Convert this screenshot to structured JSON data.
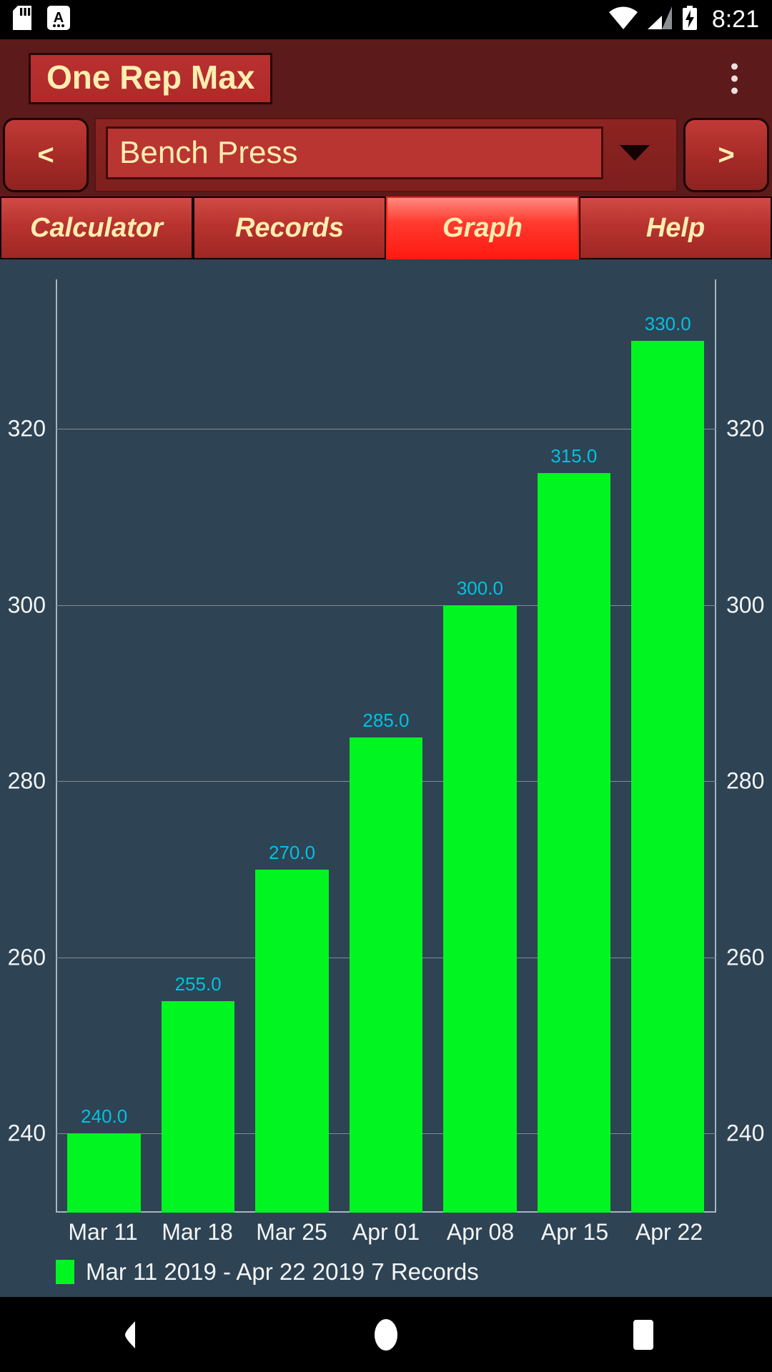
{
  "status_bar": {
    "icons_left": [
      "sd-card-icon",
      "keyboard-language-icon"
    ],
    "icons_right": [
      "wifi-icon",
      "cell-signal-icon",
      "battery-charging-icon"
    ],
    "time": "8:21"
  },
  "app_bar": {
    "title": "One Rep Max",
    "overflow_menu": "overflow-menu-icon",
    "title_text_color": "#ffeeb0",
    "title_box_color": "#b93030",
    "bar_color": "#5c1a1a"
  },
  "selector": {
    "prev_label": "<",
    "next_label": ">",
    "exercise_value": "Bench Press",
    "dropdown_icon": "chevron-down-icon"
  },
  "tabs": [
    {
      "label": "Calculator",
      "active": false
    },
    {
      "label": "Records",
      "active": false
    },
    {
      "label": "Graph",
      "active": true
    },
    {
      "label": "Help",
      "active": false
    }
  ],
  "chart_data": {
    "type": "bar",
    "title": "",
    "xlabel": "",
    "ylabel": "",
    "categories": [
      "Mar 11",
      "Mar 18",
      "Mar 25",
      "Apr 01",
      "Apr 08",
      "Apr 15",
      "Apr 22"
    ],
    "values": [
      240.0,
      255.0,
      270.0,
      285.0,
      300.0,
      315.0,
      330.0
    ],
    "value_labels": [
      "240.0",
      "255.0",
      "270.0",
      "285.0",
      "300.0",
      "315.0",
      "330.0"
    ],
    "yticks": [
      240,
      260,
      280,
      300,
      320
    ],
    "ytick_labels": [
      "240",
      "260",
      "280",
      "300",
      "320"
    ],
    "ylim": [
      231,
      337
    ],
    "y_axis_both_sides": true,
    "grid": true,
    "bar_color": "#00f521",
    "value_label_color": "#00c2e0",
    "plot_background": "#2e4354",
    "axis_text_color": "#f3f5f6",
    "legend_position": "bottom-left",
    "legend": {
      "swatch_color": "#00f521",
      "text": "Mar 11 2019 - Apr 22 2019   7 Records"
    }
  },
  "nav_bar": {
    "back": "back-triangle-icon",
    "home": "home-circle-icon",
    "recents": "recents-square-icon"
  }
}
